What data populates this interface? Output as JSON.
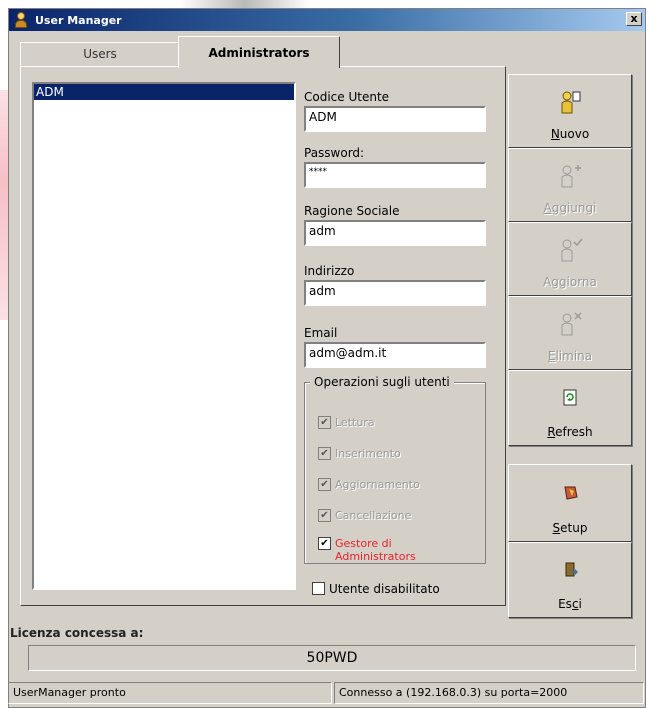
{
  "window": {
    "title": "User Manager",
    "close_glyph": "x"
  },
  "tabs": [
    {
      "label": "Users",
      "active": false
    },
    {
      "label": "Administrators",
      "active": true
    }
  ],
  "user_list": {
    "items": [
      "ADM"
    ],
    "selected": "ADM"
  },
  "form": {
    "codice_utente": {
      "label": "Codice Utente",
      "value": "ADM"
    },
    "password": {
      "label": "Password:",
      "value": "****"
    },
    "ragione_sociale": {
      "label": "Ragione Sociale",
      "value": "adm"
    },
    "indirizzo": {
      "label": "Indirizzo",
      "value": "adm"
    },
    "email": {
      "label": "Email",
      "value": "adm@adm.it"
    }
  },
  "operations": {
    "title": "Operazioni sugli utenti",
    "items": [
      {
        "label": "Lettura",
        "checked": true,
        "enabled": false
      },
      {
        "label": "Inserimento",
        "checked": true,
        "enabled": false
      },
      {
        "label": "Aggiornamento",
        "checked": true,
        "enabled": false
      },
      {
        "label": "Cancellazione",
        "checked": true,
        "enabled": false
      },
      {
        "label": "Gestore di Administrators",
        "checked": true,
        "enabled": true
      }
    ]
  },
  "disable_user": {
    "label": "Utente disabilitato",
    "checked": false
  },
  "buttons": {
    "nuovo": {
      "label": "Nuovo",
      "hotkey": "N",
      "rest": "uovo",
      "enabled": true,
      "icon": "user-new-icon"
    },
    "aggiungi": {
      "label": "Aggiungi",
      "hotkey": "A",
      "rest": "ggiungi",
      "enabled": false,
      "icon": "user-add-icon"
    },
    "aggiorna": {
      "label": "Aggiorna",
      "enabled": false,
      "icon": "user-update-icon"
    },
    "elimina": {
      "label": "Elimina",
      "hotkey": "E",
      "rest": "limina",
      "enabled": false,
      "icon": "user-delete-icon"
    },
    "refresh": {
      "label": "Refresh",
      "hotkey": "R",
      "rest": "efresh",
      "enabled": true,
      "icon": "refresh-icon"
    },
    "setup": {
      "label": "Setup",
      "hotkey": "S",
      "rest": "etup",
      "enabled": true,
      "icon": "setup-icon"
    },
    "esci": {
      "label": "Esci",
      "pre": "Es",
      "hotkey": "c",
      "rest": "i",
      "enabled": true,
      "icon": "exit-icon"
    }
  },
  "license": {
    "label": "Licenza concessa a:",
    "value": "50PWD"
  },
  "status_bar": {
    "left": "UserManager pronto",
    "right": "Connesso a (192.168.0.3) su porta=2000"
  },
  "colors": {
    "selection": "#0a246a",
    "face": "#d4d0c8",
    "red_label": "#e8232a"
  }
}
